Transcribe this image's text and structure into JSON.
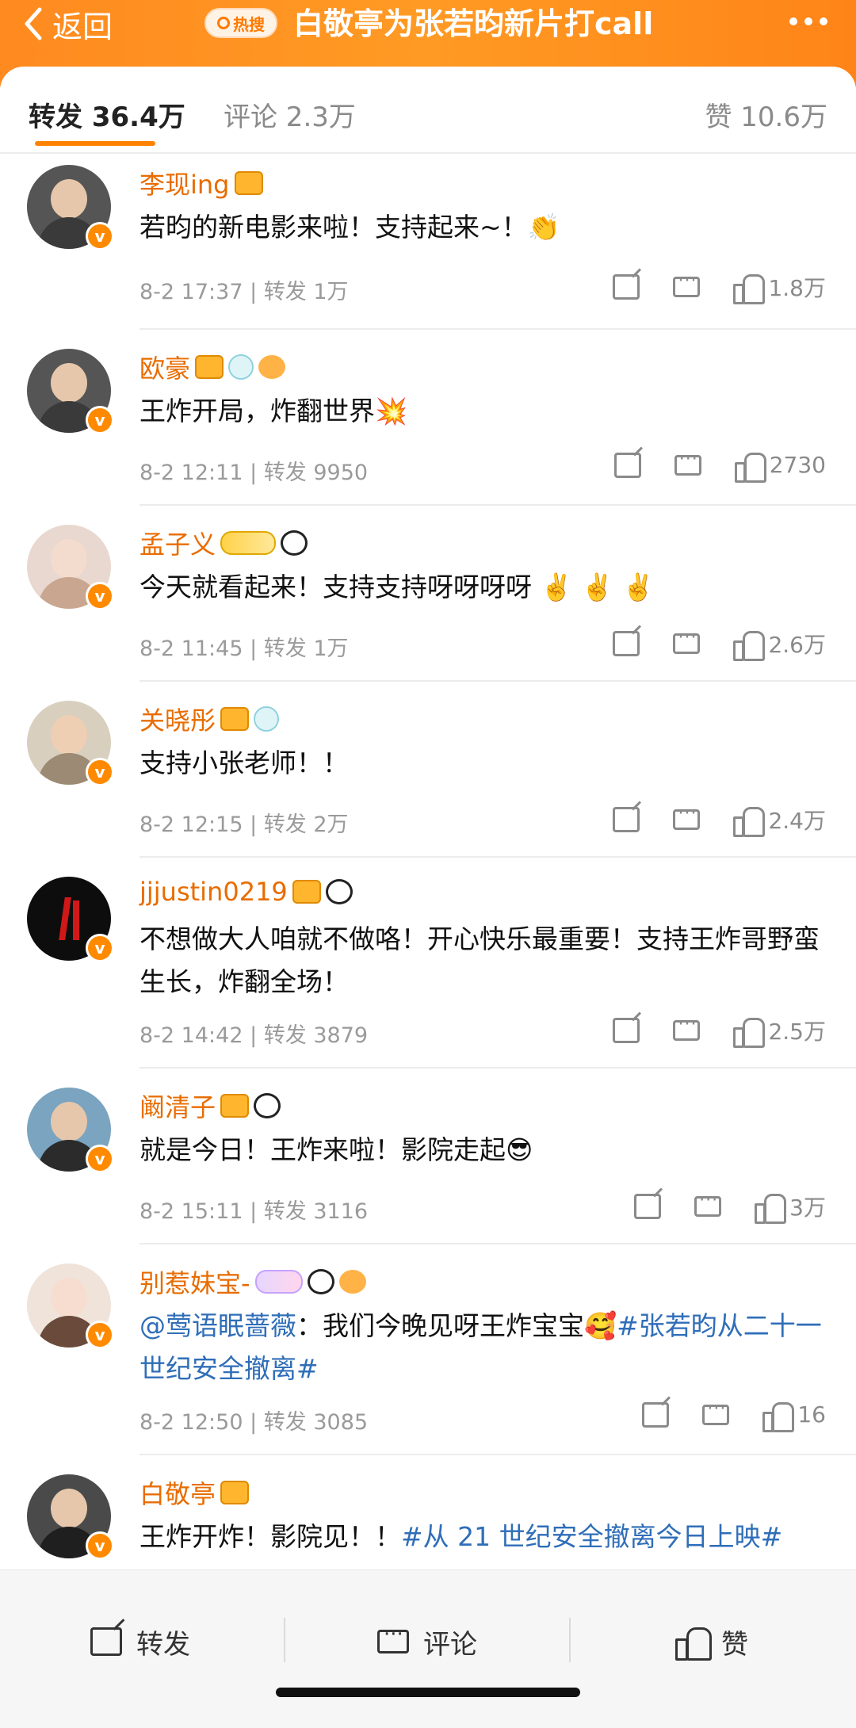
{
  "header": {
    "back_label": "返回",
    "hot_badge": "热搜",
    "title": "白敬亭为张若昀新片打call"
  },
  "tabs": {
    "repost": "转发 36.4万",
    "comment": "评论 2.3万",
    "like": "赞 10.6万"
  },
  "posts": [
    {
      "name": "李现ing",
      "text": "若昀的新电影来啦！支持起来~！👏",
      "meta": "8-2 17:37 | 转发 1万",
      "likes": "1.8万"
    },
    {
      "name": "欧豪",
      "text": "王炸开局，炸翻世界💥",
      "meta": "8-2 12:11 | 转发 9950",
      "likes": "2730"
    },
    {
      "name": "孟子义",
      "text": "今天就看起来！支持支持呀呀呀呀 ✌️ ✌️ ✌️",
      "meta": "8-2 11:45 | 转发 1万",
      "likes": "2.6万"
    },
    {
      "name": "关晓彤",
      "text": "支持小张老师！！",
      "meta": "8-2 12:15 | 转发 2万",
      "likes": "2.4万"
    },
    {
      "name": "jjjustin0219",
      "text": "不想做大人咱就不做咯！开心快乐最重要！支持王炸哥野蛮生长，炸翻全场！",
      "meta": "8-2 14:42 | 转发 3879",
      "likes": "2.5万"
    },
    {
      "name": "阚清子",
      "text": "就是今日！王炸来啦！影院走起😎",
      "meta": "8-2 15:11 | 转发 3116",
      "likes": "3万"
    },
    {
      "name": "别惹妹宝-",
      "mention": "@莺语眠蔷薇",
      "text_mid": "：我们今晚见呀王炸宝宝🥰",
      "tag": "#张若昀从二十一世纪安全撤离#",
      "meta": "8-2 12:50 | 转发 3085",
      "likes": "16"
    },
    {
      "name": "白敬亭",
      "text_pre": "王炸开炸！影院见！！",
      "tag": "#从 21 世纪安全撤离今日上映#"
    }
  ],
  "bottom": {
    "repost": "转发",
    "comment": "评论",
    "like": "赞"
  }
}
